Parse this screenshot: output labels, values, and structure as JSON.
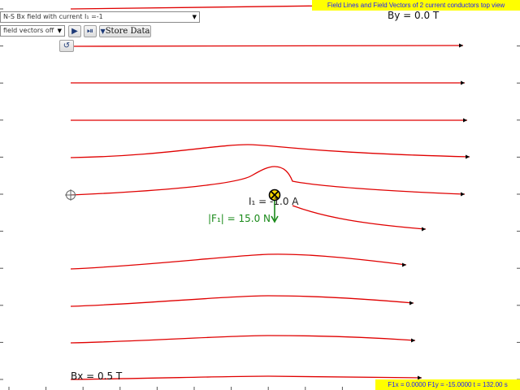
{
  "controls": {
    "mode_select": "N-S Bx field with current I₁ =-1",
    "view_select": "field vectors off",
    "play_label": "▶",
    "step_label": "⏯",
    "store_label": "Store Data",
    "reset_label": "↺"
  },
  "banners": {
    "title": "Field Lines and Field Vectors of 2 current conductors top view",
    "status": "F1x = 0.0000 F1y = -15.0000 t = 132.00 s"
  },
  "readouts": {
    "by": "By = 0.0 T",
    "bx": "Bx = 0.5 T",
    "current": "I₁ = -1.0 A",
    "force": "|F₁| = 15.0 N"
  },
  "colors": {
    "field_line": "#e00000",
    "force_vector": "#1a8a1a",
    "conductor_fill": "#ffd800",
    "banner_bg": "#ffff00",
    "banner_text": "#1a1aff"
  }
}
